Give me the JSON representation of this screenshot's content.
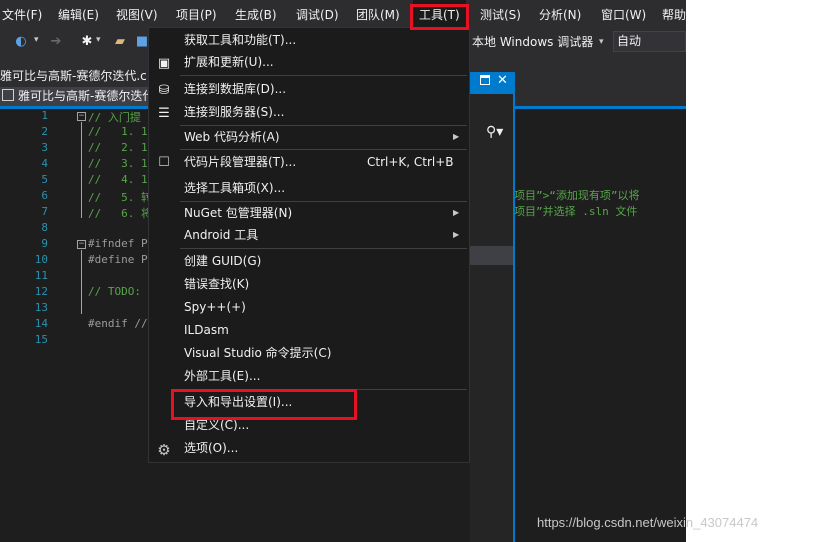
{
  "menubar": {
    "items": [
      "文件(F)",
      "编辑(E)",
      "视图(V)",
      "项目(P)",
      "生成(B)",
      "调试(D)",
      "团队(M)",
      "工具(T)",
      "测试(S)",
      "分析(N)",
      "窗口(W)",
      "帮助"
    ]
  },
  "toolbar": {
    "debugger_label": "本地 Windows 调试器",
    "config_value": "自动"
  },
  "tabs": {
    "file_tab_1": "雅可比与高斯-赛德尔迭代.c",
    "file_tab_2": "雅可比与高斯-赛德尔迭代"
  },
  "editor": {
    "line_numbers": [
      "1",
      "2",
      "3",
      "4",
      "5",
      "6",
      "7",
      "8",
      "9",
      "10",
      "11",
      "12",
      "13",
      "14",
      "15"
    ],
    "lines": {
      "l1": "// 入门提",
      "l2": "//   1. 1",
      "l3": "//   2. 1",
      "l4": "//   3. 1",
      "l5": "//   4. 1",
      "l6": "//   5. 转",
      "l7": "//   6. 将",
      "l9": "#ifndef P",
      "l10": "#define P",
      "l12": "// TODO:",
      "l14": "#endif //"
    },
    "right_comment_1": "项目”>“添加现有项”以将",
    "right_comment_2": "项目”并选择 .sln 文件"
  },
  "tools_menu": {
    "get_tools": "获取工具和功能(T)...",
    "extensions": "扩展和更新(U)...",
    "connect_db": "连接到数据库(D)...",
    "connect_server": "连接到服务器(S)...",
    "web_analysis": "Web 代码分析(A)",
    "snippet_manager": "代码片段管理器(T)...",
    "snippet_shortcut": "Ctrl+K, Ctrl+B",
    "choose_toolbox": "选择工具箱项(X)...",
    "nuget": "NuGet 包管理器(N)",
    "android": "Android 工具",
    "create_guid": "创建 GUID(G)",
    "error_lookup": "错误查找(K)",
    "spy": "Spy++(+)",
    "ildasm": "ILDasm",
    "vs_cmd": "Visual Studio 命令提示(C)",
    "external_tools": "外部工具(E)...",
    "import_export": "导入和导出设置(I)...",
    "customize": "自定义(C)...",
    "options": "选项(O)..."
  },
  "watermark": "https://blog.csdn.net/weixin_43074474",
  "colors": {
    "highlight_red": "#e81123",
    "accent_blue": "#007acc",
    "menu_bg": "#1b1b1c",
    "editor_bg": "#1e1e1e",
    "comment_green": "#57a64a",
    "line_number": "#2b91af"
  }
}
